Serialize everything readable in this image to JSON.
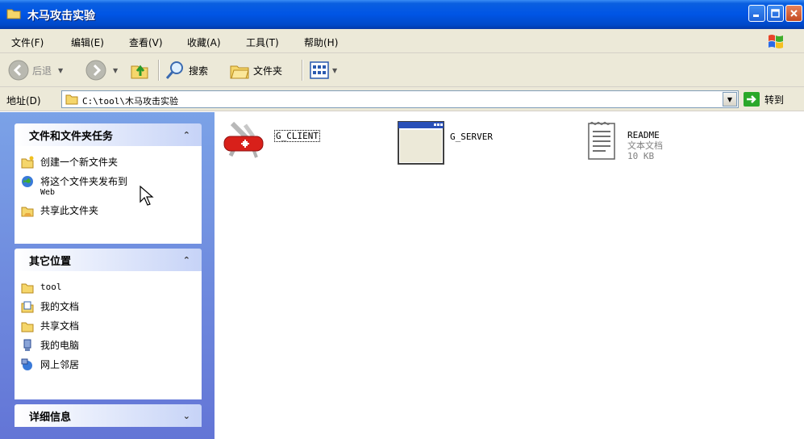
{
  "window": {
    "title": "木马攻击实验"
  },
  "menu": [
    {
      "label": "文件(F)"
    },
    {
      "label": "编辑(E)"
    },
    {
      "label": "查看(V)"
    },
    {
      "label": "收藏(A)"
    },
    {
      "label": "工具(T)"
    },
    {
      "label": "帮助(H)"
    }
  ],
  "toolbar": {
    "back_label": "后退",
    "search_label": "搜索",
    "folders_label": "文件夹"
  },
  "address": {
    "label": "地址(D)",
    "value": "C:\\tool\\木马攻击实验",
    "go_label": "转到"
  },
  "tasks": {
    "title": "文件和文件夹任务",
    "items": [
      {
        "label": "创建一个新文件夹",
        "icon": "new-folder-icon"
      },
      {
        "label": "将这个文件夹发布到",
        "label2": "Web",
        "icon": "publish-web-icon"
      },
      {
        "label": "共享此文件夹",
        "icon": "share-folder-icon"
      }
    ]
  },
  "places": {
    "title": "其它位置",
    "items": [
      {
        "label": "tool",
        "icon": "folder-icon"
      },
      {
        "label": "我的文档",
        "icon": "my-documents-icon"
      },
      {
        "label": "共享文档",
        "icon": "shared-folder-icon"
      },
      {
        "label": "我的电脑",
        "icon": "my-computer-icon"
      },
      {
        "label": "网上邻居",
        "icon": "network-icon"
      }
    ]
  },
  "details": {
    "title": "详细信息"
  },
  "files": [
    {
      "name": "G_CLIENT",
      "icon": "swiss-knife-icon"
    },
    {
      "name": "G_SERVER",
      "icon": "application-window-icon"
    },
    {
      "name": "README",
      "type": "文本文档",
      "size": "10 KB",
      "icon": "text-document-icon"
    }
  ]
}
